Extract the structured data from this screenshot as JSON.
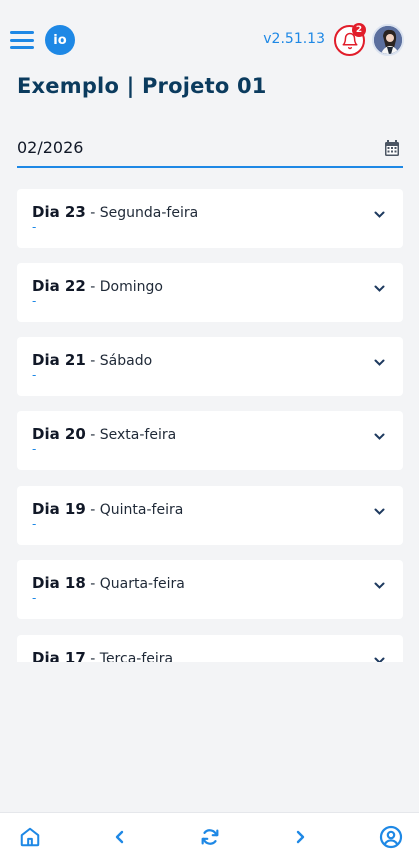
{
  "header": {
    "logo_text": "io",
    "version": "v2.51.13",
    "notifications_count": "2"
  },
  "page": {
    "title": "Exemplo | Projeto 01",
    "date_value": "02/2026"
  },
  "days": [
    {
      "label": "Dia 23",
      "weekday": "Segunda-feira",
      "detail": "-"
    },
    {
      "label": "Dia 22",
      "weekday": "Domingo",
      "detail": "-"
    },
    {
      "label": "Dia 21",
      "weekday": "Sábado",
      "detail": "-"
    },
    {
      "label": "Dia 20",
      "weekday": "Sexta-feira",
      "detail": "-"
    },
    {
      "label": "Dia 19",
      "weekday": "Quinta-feira",
      "detail": "-"
    },
    {
      "label": "Dia 18",
      "weekday": "Quarta-feira",
      "detail": "-"
    },
    {
      "label": "Dia 17",
      "weekday": "Terça-feira",
      "detail": "-"
    }
  ],
  "separator": " - ",
  "icons": {
    "menu": "menu-icon",
    "bell": "bell-icon",
    "calendar": "calendar-icon",
    "chevron": "chevron-down-icon",
    "home": "home-icon",
    "prev": "chevron-left-icon",
    "refresh": "refresh-icon",
    "next": "chevron-right-icon",
    "profile": "user-circle-icon"
  },
  "colors": {
    "accent": "#1e88e5",
    "title": "#0b3b5e",
    "alert": "#e11d2a",
    "background": "#f3f4f6"
  }
}
